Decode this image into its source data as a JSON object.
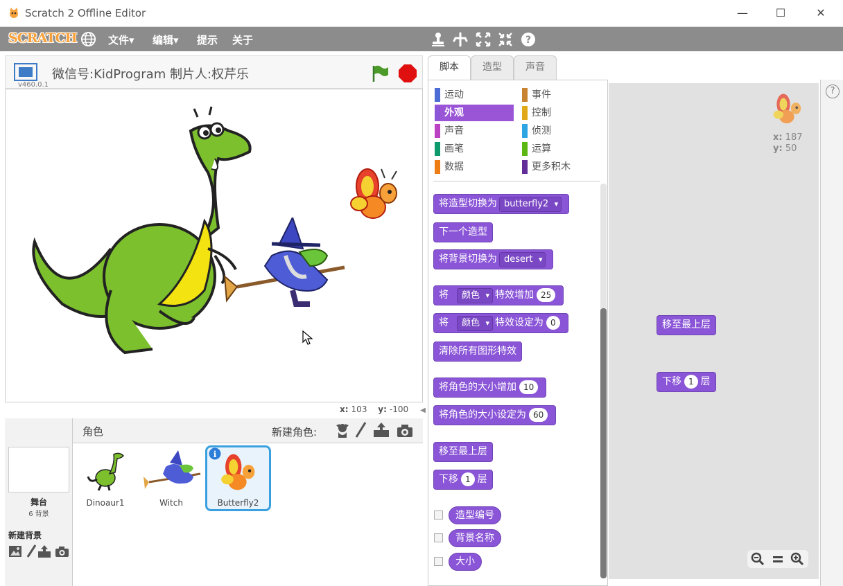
{
  "window": {
    "title": "Scratch 2 Offline Editor"
  },
  "menu": {
    "file": "文件▾",
    "edit": "编辑▾",
    "tips": "提示",
    "about": "关于"
  },
  "logo": "SCRATCH",
  "stage": {
    "title": "微信号:KidProgram 制片人:权芹乐",
    "version": "v460.0.1",
    "x_label": "x:",
    "x_value": "103",
    "y_label": "y:",
    "y_value": "-100"
  },
  "sprites_panel": {
    "header": "角色",
    "new_sprite": "新建角色:",
    "stage_label": "舞台",
    "backdrops_count": "6 背景",
    "new_backdrop": "新建背景",
    "sprites": [
      {
        "name": "Dinoaur1"
      },
      {
        "name": "Witch"
      },
      {
        "name": "Butterfly2"
      }
    ]
  },
  "tabs": [
    "脚本",
    "造型",
    "声音"
  ],
  "categories": [
    {
      "label": "运动",
      "color": "#4a6cd4"
    },
    {
      "label": "事件",
      "color": "#c88330"
    },
    {
      "label": "外观",
      "color": "#8a55d7"
    },
    {
      "label": "控制",
      "color": "#e1a91a"
    },
    {
      "label": "声音",
      "color": "#bb42c3"
    },
    {
      "label": "侦测",
      "color": "#2ca5e2"
    },
    {
      "label": "画笔",
      "color": "#0e9a6c"
    },
    {
      "label": "运算",
      "color": "#5cb712"
    },
    {
      "label": "数据",
      "color": "#ee7d16"
    },
    {
      "label": "更多积木",
      "color": "#632d99"
    }
  ],
  "blocks": {
    "switch_costume": "将造型切换为",
    "costume_value": "butterfly2",
    "next_costume": "下一个造型",
    "switch_backdrop": "将背景切换为",
    "backdrop_value": "desert",
    "effect_change_pre": "将",
    "effect_name": "颜色",
    "effect_change_post": "特效增加",
    "effect_change_val": "25",
    "effect_set_pre": "将",
    "effect_set_name": "颜色",
    "effect_set_post": "特效设定为",
    "effect_set_val": "0",
    "clear_effects": "清除所有图形特效",
    "size_change": "将角色的大小增加",
    "size_change_val": "10",
    "size_set": "将角色的大小设定为",
    "size_set_val": "60",
    "go_front": "移至最上层",
    "go_back_pre": "下移",
    "go_back_val": "1",
    "go_back_post": "层",
    "costume_num": "造型编号",
    "backdrop_name": "背景名称",
    "size": "大小"
  },
  "script_area": {
    "block1": "移至最上层",
    "block2_pre": "下移",
    "block2_val": "1",
    "block2_post": "层",
    "x_label": "x:",
    "x_value": "187",
    "y_label": "y:",
    "y_value": "50"
  }
}
